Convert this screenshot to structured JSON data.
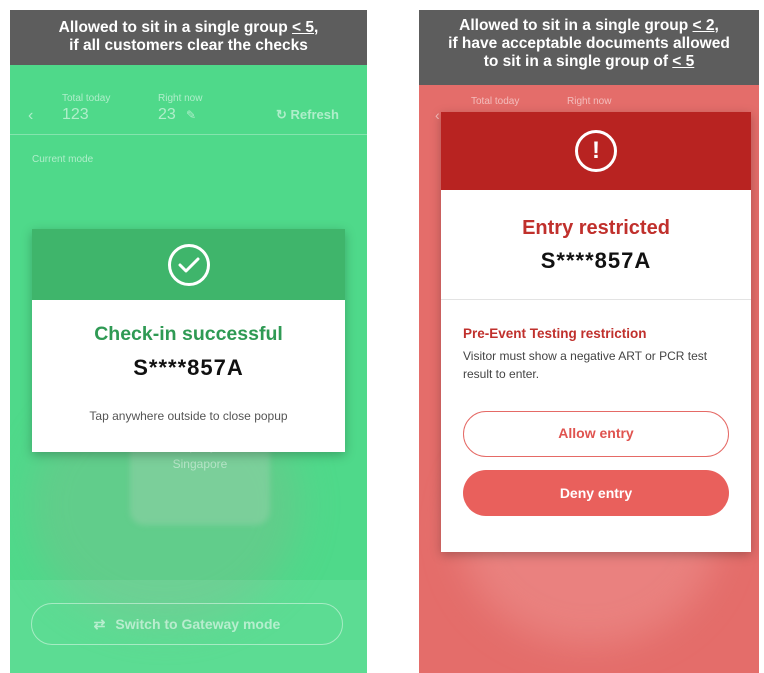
{
  "left": {
    "caption_line1_prefix": "Allowed to sit in a single group ",
    "caption_line1_value": "< 5,",
    "caption_line2": "if all customers clear the checks",
    "header": {
      "total_label": "Total today",
      "total_value": "123",
      "now_label": "Right now",
      "now_value": "23",
      "refresh_label": "Refresh"
    },
    "mode_label": "Current mode",
    "bg_text": "Property of Singapore",
    "popup": {
      "title": "Check-in successful",
      "id": "S****857A",
      "hint": "Tap anywhere outside to close popup"
    },
    "gateway_label": "Switch to Gateway mode"
  },
  "right": {
    "caption_line1_prefix": "Allowed to sit in a single group ",
    "caption_line1_value": "< 2,",
    "caption_line2": "if have acceptable documents allowed",
    "caption_line3_prefix": "to sit in a single group of ",
    "caption_line3_value": "< 5",
    "header": {
      "total_label": "Total today",
      "now_label": "Right now"
    },
    "popup": {
      "title": "Entry restricted",
      "id": "S****857A",
      "restriction_title": "Pre-Event Testing restriction",
      "restriction_text": "Visitor must show a negative ART or PCR test result to enter.",
      "allow_label": "Allow entry",
      "deny_label": "Deny entry"
    }
  },
  "colors": {
    "green_bg": "#4fd98a",
    "green_band": "#3fb56b",
    "red_bg": "#e46d6a",
    "red_band": "#b82321"
  }
}
